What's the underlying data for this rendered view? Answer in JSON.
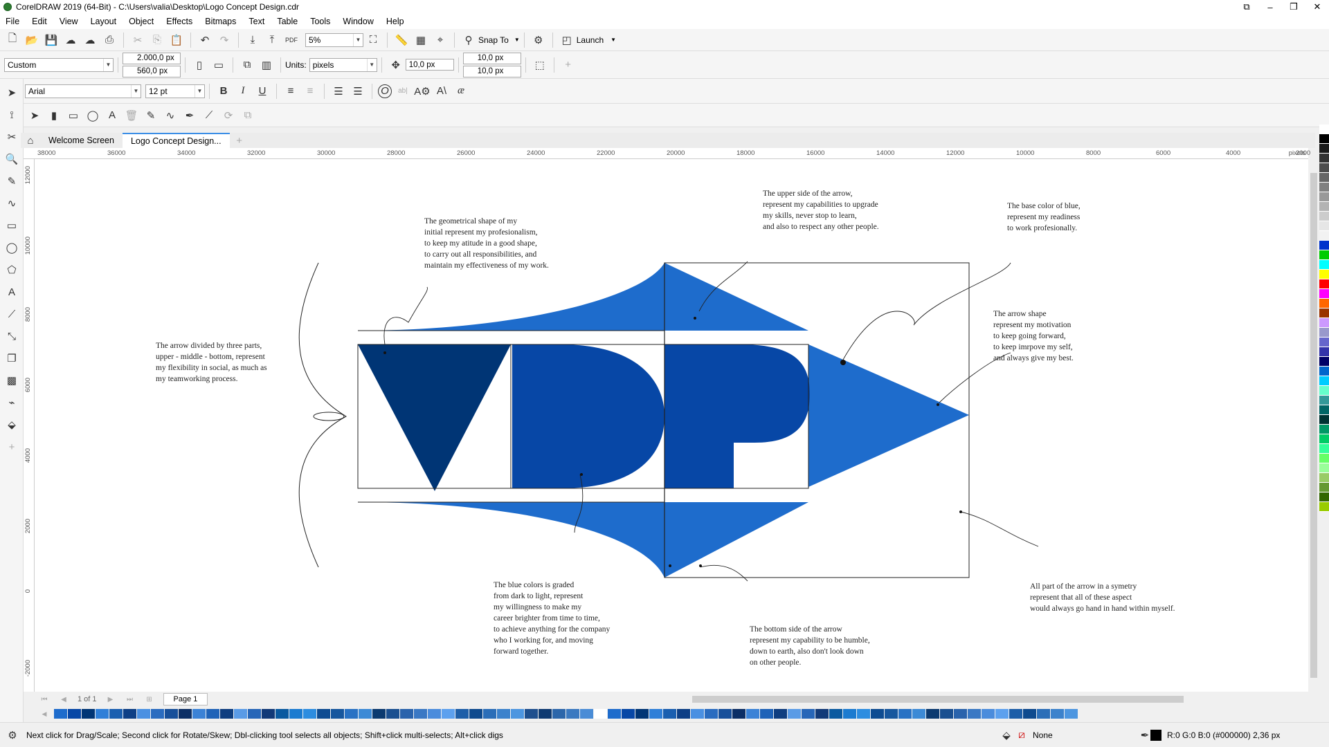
{
  "window": {
    "title": "CorelDRAW 2019 (64-Bit) - C:\\Users\\valia\\Desktop\\Logo Concept Design.cdr"
  },
  "menu": [
    "File",
    "Edit",
    "View",
    "Layout",
    "Object",
    "Effects",
    "Bitmaps",
    "Text",
    "Table",
    "Tools",
    "Window",
    "Help"
  ],
  "toolbar": {
    "zoom": "5%",
    "snap_to": "Snap To",
    "launch": "Launch"
  },
  "property_bar": {
    "preset": "Custom",
    "width": "2.000,0 px",
    "height": "560,0 px",
    "units_label": "Units:",
    "units": "pixels",
    "nudge": "10,0 px",
    "dup_x": "10,0 px",
    "dup_y": "10,0 px"
  },
  "text_bar": {
    "font": "Arial",
    "size": "12 pt"
  },
  "tabs": [
    {
      "label": "Welcome Screen"
    },
    {
      "label": "Logo Concept Design..."
    }
  ],
  "ruler_h": [
    "38000",
    "36000",
    "34000",
    "32000",
    "30000",
    "28000",
    "26000",
    "24000",
    "22000",
    "20000",
    "18000",
    "16000",
    "14000",
    "12000",
    "10000",
    "8000",
    "6000",
    "4000",
    "2000"
  ],
  "ruler_h_unit": "pixels",
  "ruler_v": [
    "12000",
    "10000",
    "8000",
    "6000",
    "4000",
    "2000",
    "0",
    "-2000"
  ],
  "page_nav": {
    "count": "1 of 1",
    "page_tab": "Page 1"
  },
  "annotations": {
    "divided": [
      "The arrow divided by three parts,",
      "upper - middle - bottom, represent",
      "my flexibility in social, as much as",
      "my teamworking process."
    ],
    "geometrical": [
      "The geometrical shape of my",
      "initial represent my profesionalism,",
      "to keep my atitude in a good shape,",
      "to carry out all responsibilities, and",
      "maintain my effectiveness of my work."
    ],
    "upper_side": [
      "The upper side of the arrow,",
      "represent my capabilities to upgrade",
      "my skills, never stop to learn,",
      "and also to respect any other people."
    ],
    "base_color": [
      "The base color of blue,",
      "represent my readiness",
      "to work profesionally."
    ],
    "arrow_shape": [
      "The arrow shape",
      "represent my motivation",
      "to keep going forward,",
      "to keep imrpove my self,",
      "and always give my best."
    ],
    "blue_colors": [
      "The blue colors is graded",
      "from dark to light, represent",
      "my willingness to make my",
      "career brighter from time to time,",
      "to achieve anything for the company",
      "who I working for, and moving",
      "forward together."
    ],
    "bottom_side": [
      "The bottom side of the arrow",
      "represent my capability to be humble,",
      "down to earth, also don't look down",
      "on other people."
    ],
    "symetry": [
      "All part of the arrow in a symetry",
      "represent that all of these aspect",
      "would always go hand in hand within myself."
    ]
  },
  "status": {
    "hint": "Next click for Drag/Scale; Second click for Rotate/Skew; Dbl-clicking tool selects all objects; Shift+click multi-selects; Alt+click digs",
    "fill": "None",
    "outline": "R:0 G:0 B:0 (#000000)  2,36 px"
  },
  "colors": {
    "dark_navy": "#003575",
    "mid_blue": "#0747a6",
    "light_blue": "#1e6ccc",
    "accent": "#3b8ee6"
  }
}
